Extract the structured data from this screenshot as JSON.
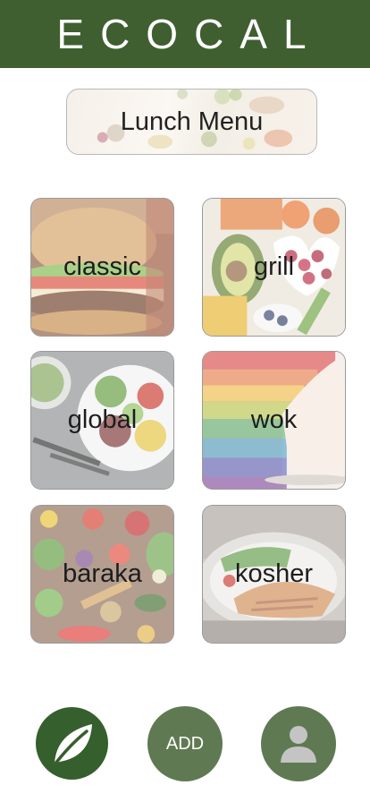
{
  "app": {
    "title": "ECOCAL"
  },
  "banner": {
    "label": "Lunch Menu"
  },
  "categories": [
    {
      "label": "classic"
    },
    {
      "label": "grill"
    },
    {
      "label": "global"
    },
    {
      "label": "wok"
    },
    {
      "label": "baraka"
    },
    {
      "label": "kosher"
    }
  ],
  "nav": {
    "home_icon": "leaf-icon",
    "add_label": "ADD",
    "profile_icon": "user-icon"
  },
  "colors": {
    "header": "#3f5f30",
    "home_button": "#355f2c",
    "nav_button": "#5f7a53"
  }
}
